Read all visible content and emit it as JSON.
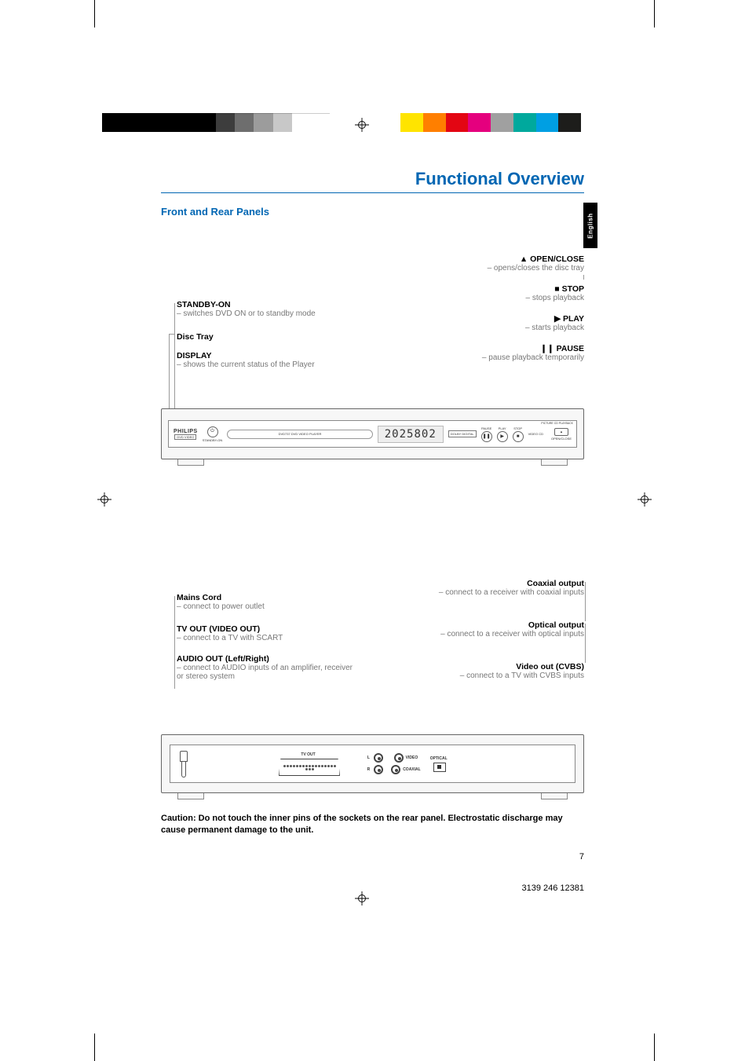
{
  "header": {
    "title": "Functional Overview",
    "subtitle": "Front and Rear Panels",
    "language_tab": "English"
  },
  "front_panel": {
    "left": [
      {
        "heading": "STANDBY-ON",
        "desc": "– switches DVD ON or to standby mode"
      },
      {
        "heading": "Disc Tray",
        "desc": ""
      },
      {
        "heading": "DISPLAY",
        "desc": "– shows the current status of the Player"
      }
    ],
    "right": [
      {
        "symbol": "▲",
        "heading": "OPEN/CLOSE",
        "desc": "– opens/closes the disc tray"
      },
      {
        "symbol": "■",
        "heading": "STOP",
        "desc": "– stops playback"
      },
      {
        "symbol": "▶",
        "heading": "PLAY",
        "desc": "– starts playback"
      },
      {
        "symbol": "❙❙",
        "heading": "PAUSE",
        "desc": "– pause playback temporarily"
      }
    ],
    "device": {
      "brand": "PHILIPS",
      "logo_sub": "DVD VIDEO",
      "standby": "STANDBY-ON",
      "tray_label": "DVD737 DVD VIDEO PLAYER",
      "display_value": "2025802",
      "badge": "DOLBY DIGITAL",
      "btn_pause": "PAUSE",
      "btn_play": "PLAY",
      "btn_stop": "STOP",
      "cd_badge": "VIDEO CD",
      "corner": "PICTURE CD PLAYBACK",
      "open_close": "OPEN/CLOSE"
    }
  },
  "rear_panel": {
    "left": [
      {
        "heading": "Mains Cord",
        "desc": "– connect to power outlet"
      },
      {
        "heading": "TV OUT (VIDEO OUT)",
        "desc": "– connect to a TV with SCART"
      },
      {
        "heading": "AUDIO OUT (Left/Right)",
        "desc": "– connect to AUDIO inputs of an amplifier, receiver or stereo system"
      }
    ],
    "right": [
      {
        "heading": "Coaxial output",
        "desc": "– connect to a receiver with coaxial inputs"
      },
      {
        "heading": "Optical output",
        "desc": "– connect to a receiver with optical inputs"
      },
      {
        "heading": "Video out (CVBS)",
        "desc": "– connect to a TV with CVBS inputs"
      }
    ],
    "device": {
      "tv_out": "TV OUT",
      "l": "L",
      "r": "R",
      "video": "VIDEO",
      "optical": "OPTICAL",
      "coaxial": "COAXIAL"
    }
  },
  "footer": {
    "caution": "Caution: Do not touch the inner pins of the sockets on the rear panel. Electrostatic discharge may cause permanent damage to the unit.",
    "page_number": "7",
    "doc_id": "3139 246 12381"
  },
  "colors": {
    "left_bar": [
      "#000",
      "#000",
      "#000",
      "#000",
      "#000",
      "#000",
      "#3d3d3d",
      "#6e6e6e",
      "#9c9c9c",
      "#c8c8c8",
      "#ffffff",
      "#ffffff"
    ],
    "right_bar": [
      "#ffe400",
      "#ff7f00",
      "#e30613",
      "#e5007e",
      "#a0a0a0",
      "#00a99d",
      "#009fe3",
      "#1d1d1b"
    ]
  }
}
